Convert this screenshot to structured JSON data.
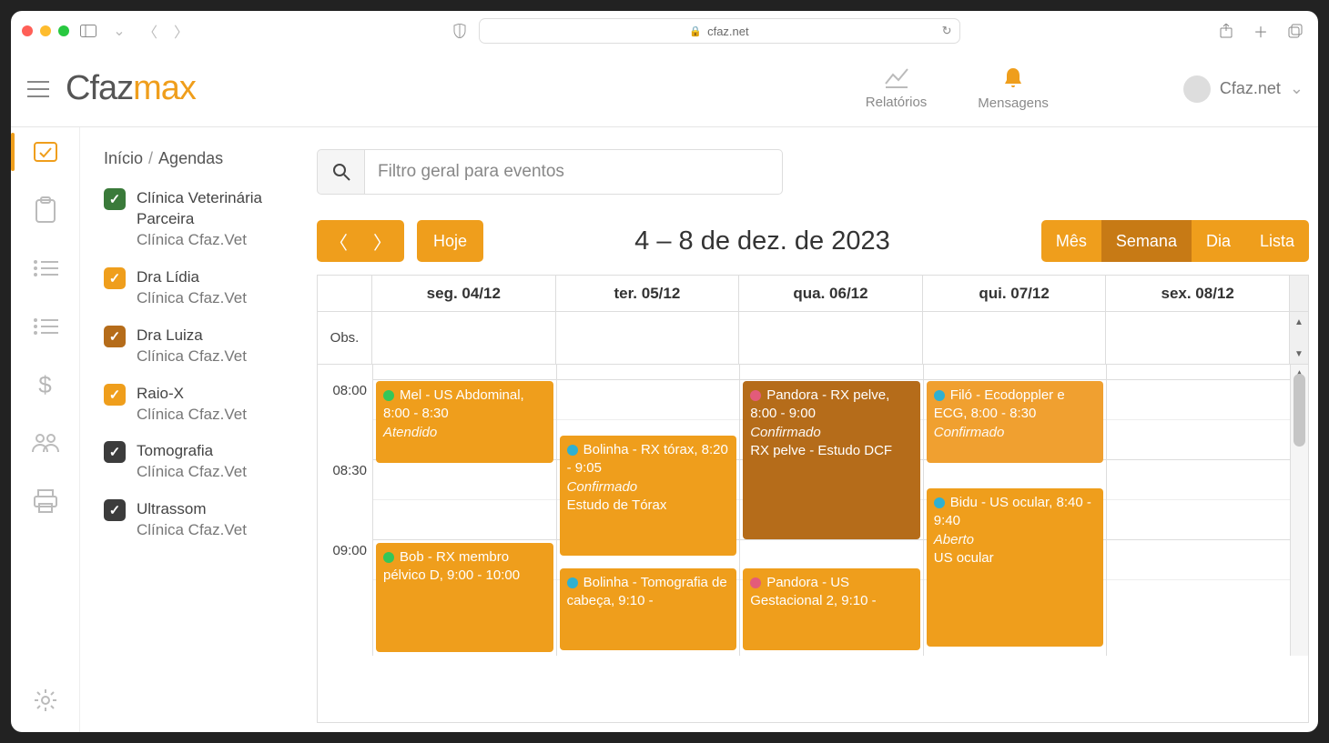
{
  "browser": {
    "url": "cfaz.net"
  },
  "header": {
    "logo_a": "Cfaz",
    "logo_b": "max",
    "reports": "Relatórios",
    "messages": "Mensagens",
    "user": "Cfaz.net"
  },
  "breadcrumb": {
    "root": "Início",
    "page": "Agendas"
  },
  "agendas": [
    {
      "name": "Clínica Veterinária Parceira",
      "sub": "Clínica Cfaz.Vet",
      "color": "green"
    },
    {
      "name": "Dra Lídia",
      "sub": "Clínica Cfaz.Vet",
      "color": "orange"
    },
    {
      "name": "Dra Luiza",
      "sub": "Clínica Cfaz.Vet",
      "color": "brown"
    },
    {
      "name": "Raio-X",
      "sub": "Clínica Cfaz.Vet",
      "color": "orange"
    },
    {
      "name": "Tomografia",
      "sub": "Clínica Cfaz.Vet",
      "color": "darkg"
    },
    {
      "name": "Ultrassom",
      "sub": "Clínica Cfaz.Vet",
      "color": "darkg"
    }
  ],
  "search": {
    "placeholder": "Filtro geral para eventos"
  },
  "toolbar": {
    "today": "Hoje",
    "title": "4 – 8 de dez. de 2023",
    "views": {
      "month": "Mês",
      "week": "Semana",
      "day": "Dia",
      "list": "Lista"
    }
  },
  "days": [
    "seg. 04/12",
    "ter. 05/12",
    "qua. 06/12",
    "qui. 07/12",
    "sex. 08/12"
  ],
  "obs_label": "Obs.",
  "times": [
    "08:00",
    "08:30",
    "09:00"
  ],
  "events": {
    "mel": {
      "title": "Mel - US Abdominal, 8:00 - 8:30",
      "status": "Atendido"
    },
    "bob": {
      "title": "Bob - RX membro pélvico D, 9:00 - 10:00"
    },
    "bolinha1": {
      "title": "Bolinha - RX tórax, 8:20 - 9:05",
      "status": "Confirmado",
      "note": "Estudo de Tórax"
    },
    "bolinha2": {
      "title": "Bolinha - Tomografia de cabeça, 9:10 -"
    },
    "pandora1": {
      "title": "Pandora - RX pelve, 8:00 - 9:00",
      "status": "Confirmado",
      "note": "RX pelve - Estudo DCF"
    },
    "pandora2": {
      "title": "Pandora - US Gestacional 2, 9:10 -"
    },
    "filo": {
      "title": "Filó - Ecodoppler e ECG, 8:00 - 8:30",
      "status": "Confirmado"
    },
    "bidu": {
      "title": "Bidu - US ocular, 8:40 - 9:40",
      "status": "Aberto",
      "note": "US ocular"
    }
  }
}
